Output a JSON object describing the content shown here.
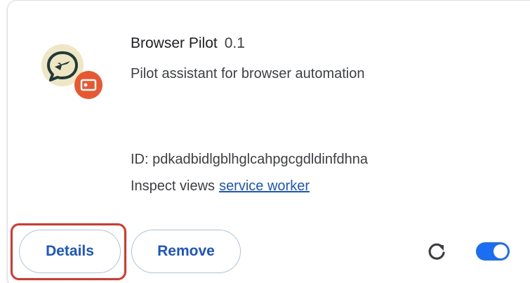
{
  "extension": {
    "name": "Browser Pilot",
    "version": "0.1",
    "description": "Pilot assistant for browser automation",
    "id_line": "ID: pdkadbidlgblhglcahpgcgdldinfdhna",
    "inspect_label": "Inspect views",
    "inspect_link": "service worker",
    "icon": "chat-bubble-plane-icon",
    "badge_icon": "unpacked-extension-badge-icon",
    "enabled": true
  },
  "actions": {
    "details_label": "Details",
    "remove_label": "Remove",
    "reload_icon": "reload-icon",
    "toggle_icon": "toggle-switch"
  },
  "colors": {
    "accent": "#1a56c9",
    "toggle_on": "#1b6ef3",
    "highlight": "#e0342a",
    "badge": "#e8572f",
    "icon_bg": "#efe6c3"
  }
}
